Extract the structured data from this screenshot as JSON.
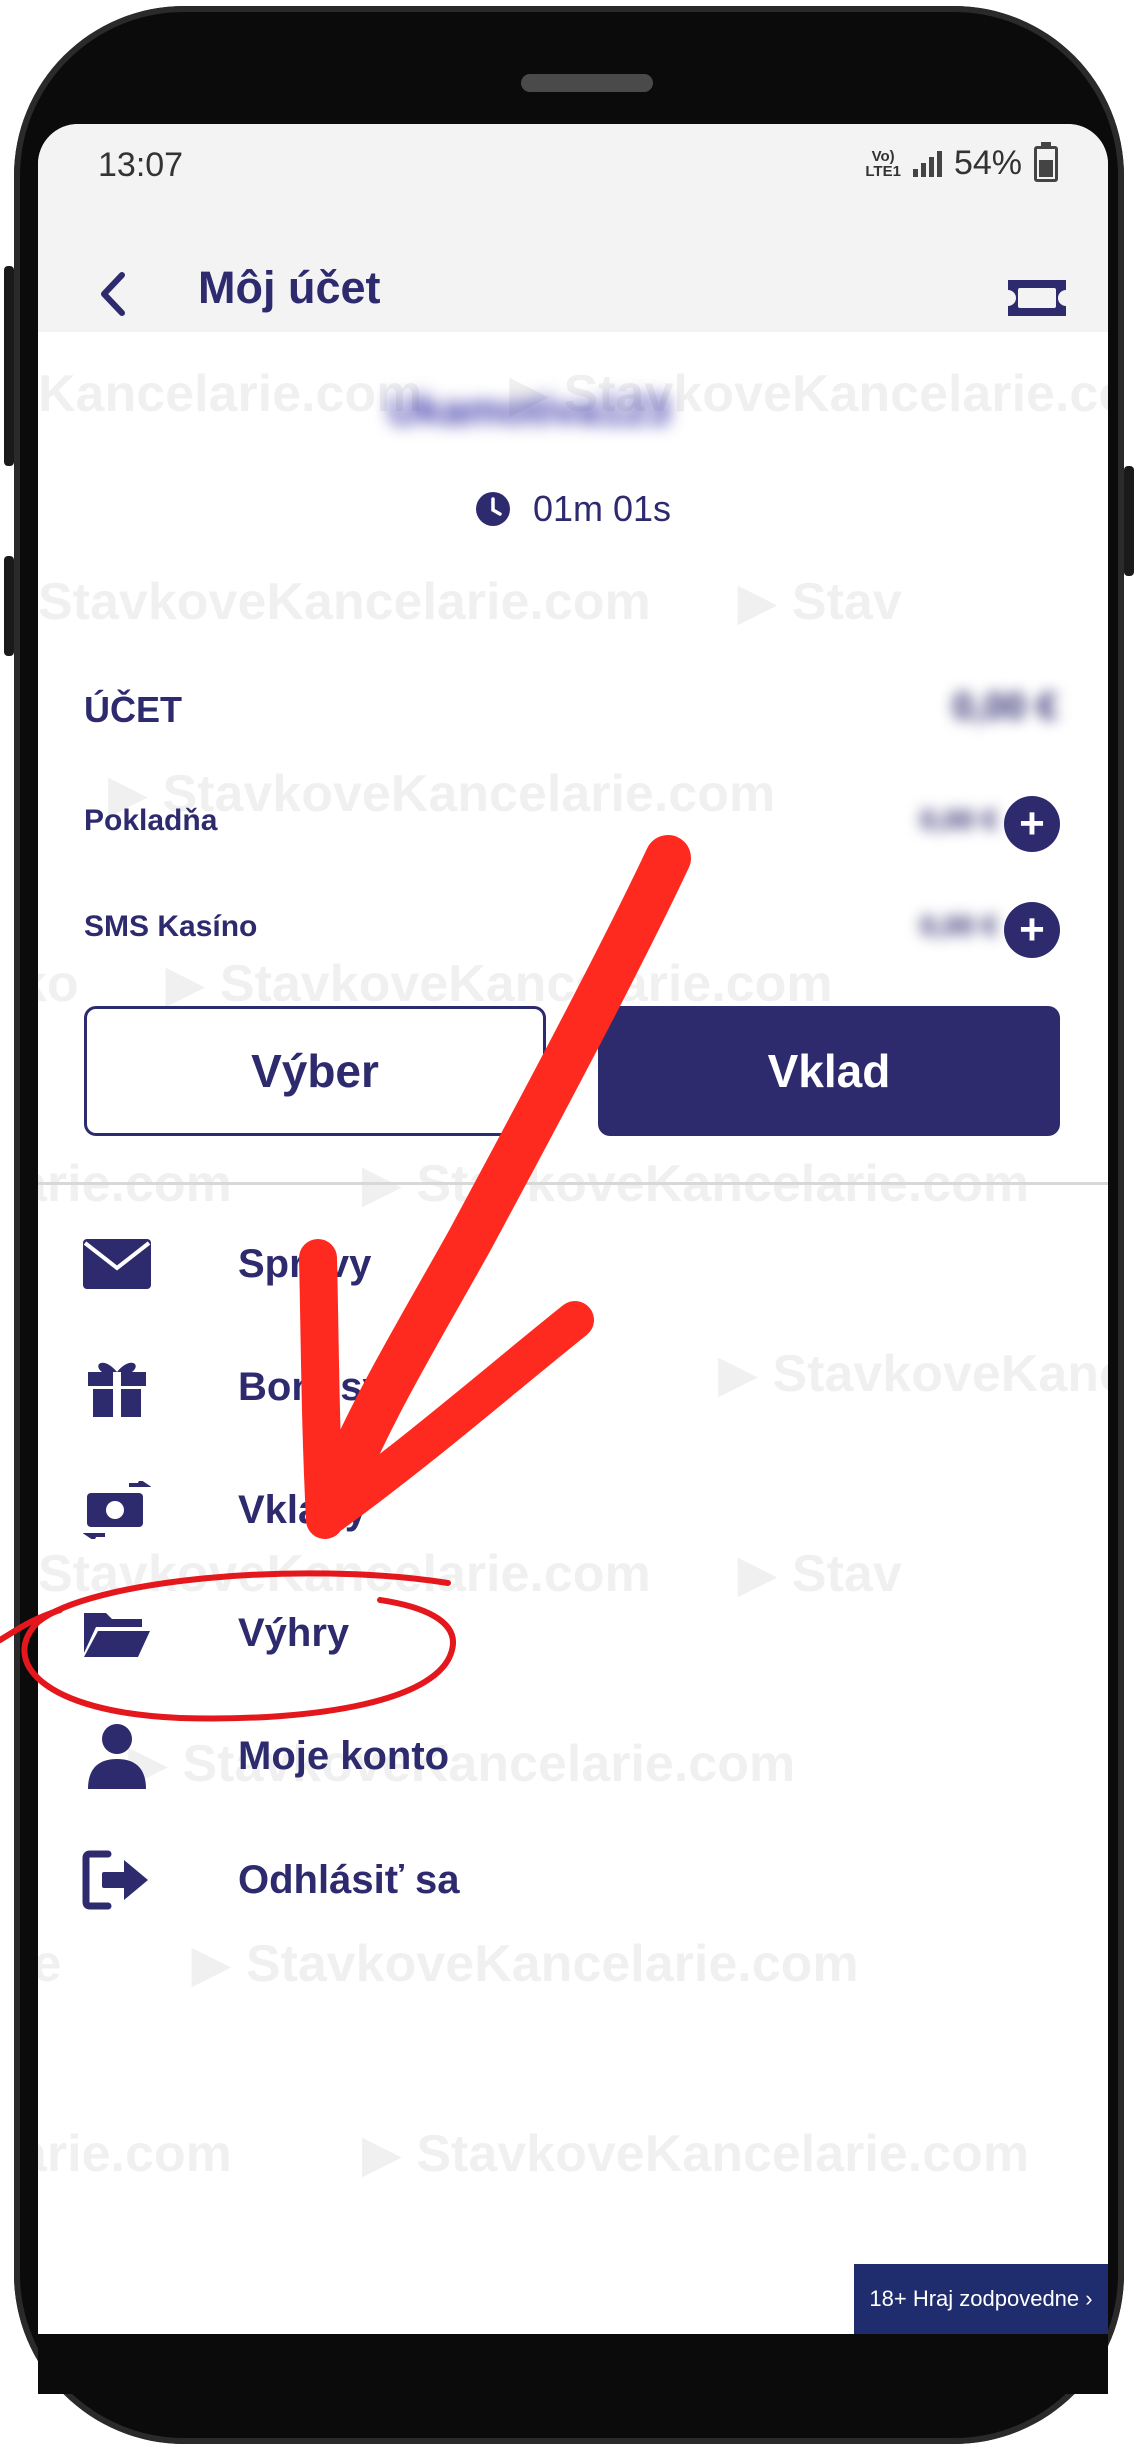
{
  "status_bar": {
    "time": "13:07",
    "network_top": "Vo)",
    "network_bottom": "LTE1",
    "battery": "54%"
  },
  "header": {
    "title": "Môj účet",
    "back_icon": "chevron-left-icon",
    "ticket_icon": "ticket-icon"
  },
  "account": {
    "username": "Ukamotiva123",
    "session_time": "01m 01s",
    "account_label": "ÚČET",
    "account_value": "0,00 €",
    "rows": [
      {
        "label": "Pokladňa",
        "value": "0,00 €"
      },
      {
        "label": "SMS Kasíno",
        "value": "0,00 €"
      }
    ]
  },
  "actions": {
    "withdraw": "Výber",
    "deposit": "Vklad"
  },
  "menu": [
    {
      "label": "Správy",
      "icon": "envelope-icon"
    },
    {
      "label": "Bonusy",
      "icon": "gift-icon"
    },
    {
      "label": "Vklady",
      "icon": "money-transfer-icon"
    },
    {
      "label": "Výhry",
      "icon": "folder-open-icon"
    },
    {
      "label": "Moje konto",
      "icon": "user-icon"
    },
    {
      "label": "Odhlásiť sa",
      "icon": "logout-icon"
    }
  ],
  "footer": {
    "responsible_gaming": "18+ Hraj zodpovedne ›"
  },
  "watermark": "StavkoveKancelarie.com",
  "colors": {
    "brand": "#2e2a6e",
    "header_bg": "#f4f3f3",
    "annotation": "#ff2a1f",
    "badge_bg": "#1f2d6e"
  }
}
